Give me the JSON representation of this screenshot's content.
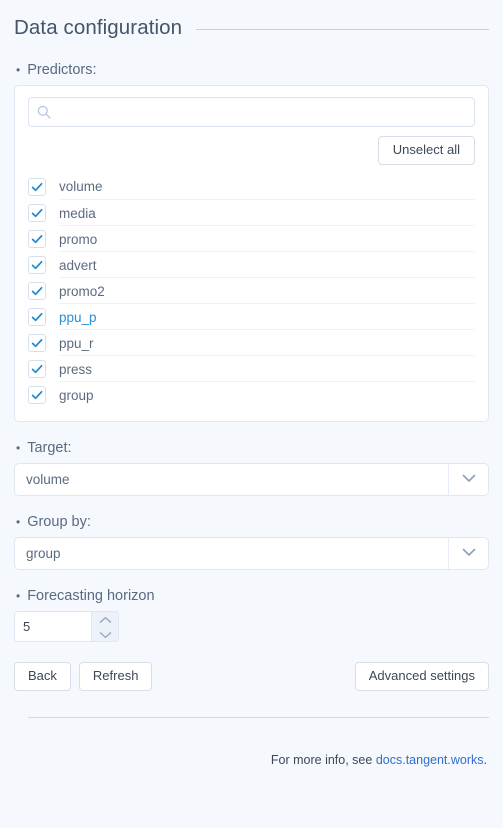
{
  "header": {
    "title": "Data configuration"
  },
  "predictors": {
    "label": "Predictors:",
    "bullet": "•",
    "search": {
      "value": "",
      "placeholder": "",
      "icon": "search-icon"
    },
    "unselect_all_label": "Unselect all",
    "items": [
      {
        "label": "volume",
        "checked": true,
        "hovered": false
      },
      {
        "label": "media",
        "checked": true,
        "hovered": false
      },
      {
        "label": "promo",
        "checked": true,
        "hovered": false
      },
      {
        "label": "advert",
        "checked": true,
        "hovered": false
      },
      {
        "label": "promo2",
        "checked": true,
        "hovered": false
      },
      {
        "label": "ppu_p",
        "checked": true,
        "hovered": true
      },
      {
        "label": "ppu_r",
        "checked": true,
        "hovered": false
      },
      {
        "label": "press",
        "checked": true,
        "hovered": false
      },
      {
        "label": "group",
        "checked": true,
        "hovered": false
      }
    ]
  },
  "target": {
    "label": "Target:",
    "bullet": "•",
    "value": "volume"
  },
  "group_by": {
    "label": "Group by:",
    "bullet": "•",
    "value": "group"
  },
  "forecasting_horizon": {
    "label": "Forecasting horizon",
    "bullet": "•",
    "value": "5"
  },
  "actions": {
    "back_label": "Back",
    "refresh_label": "Refresh",
    "advanced_settings_label": "Advanced settings"
  },
  "footer": {
    "text_prefix": "For more info, see ",
    "link_label": "docs.tangent.works",
    "text_suffix": "."
  },
  "colors": {
    "page_background": "#f5f8fd",
    "text": "#44546a",
    "accent_blue": "#2a8fd4",
    "link_blue": "#2f6fd0",
    "card_border": "#dfe7f3",
    "checkbox_check": "#1f87cf"
  }
}
